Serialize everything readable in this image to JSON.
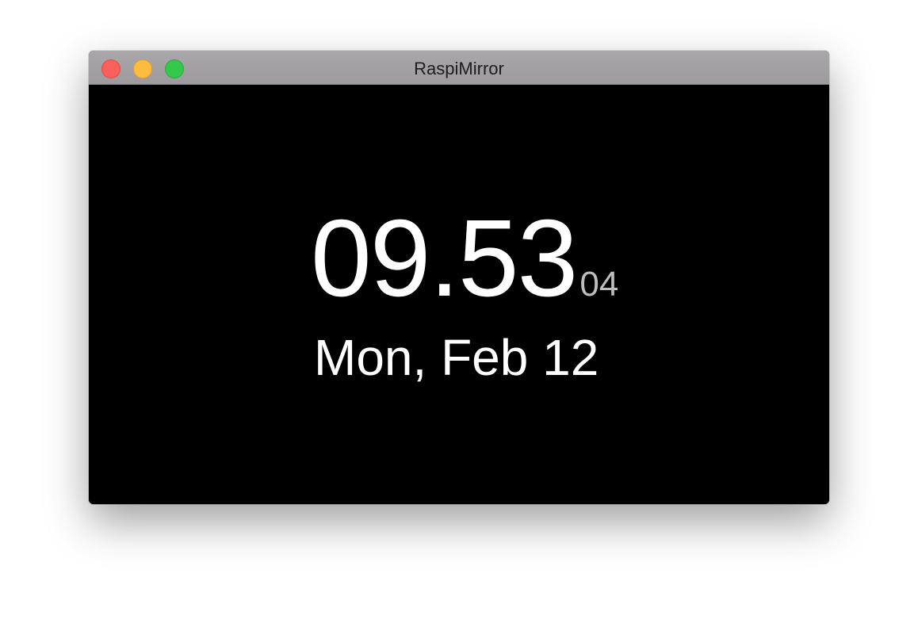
{
  "window": {
    "title": "RaspiMirror",
    "controls": {
      "close_color": "#fc605b",
      "minimize_color": "#fdbc40",
      "zoom_color": "#34c84a"
    }
  },
  "clock": {
    "time": "09.53",
    "seconds": "04",
    "date": "Mon, Feb 12"
  },
  "colors": {
    "background": "#000000",
    "time_text": "#ffffff",
    "seconds_text": "#bdbdbd"
  }
}
